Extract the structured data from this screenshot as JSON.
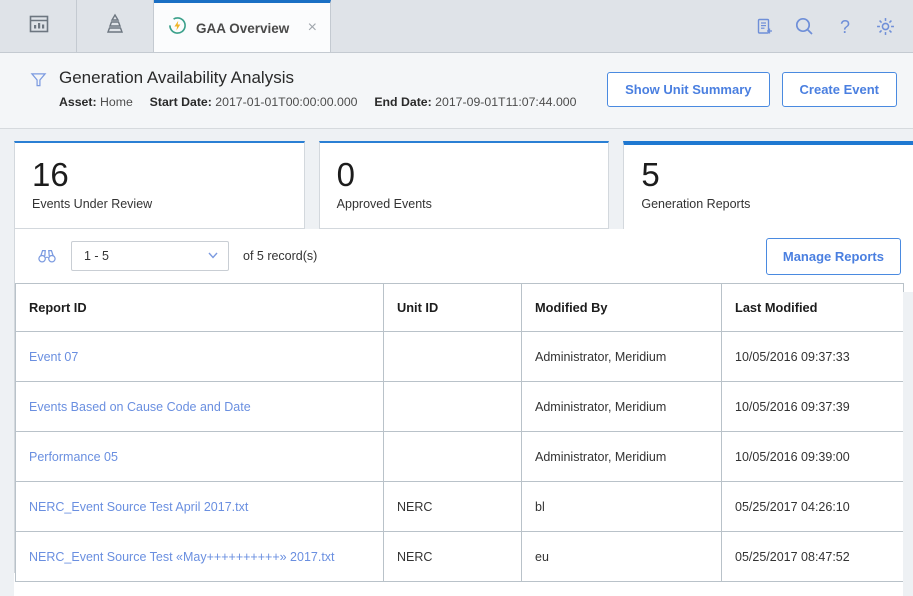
{
  "tabbar": {
    "tools": [
      {
        "name": "dashboard-icon",
        "label": "Dashboard"
      },
      {
        "name": "hierarchy-icon",
        "label": "Asset Hierarchy"
      }
    ],
    "document_tab": {
      "title": "GAA Overview",
      "icon": "gaa-bolt-icon",
      "close_label": "×"
    },
    "right_tools": [
      {
        "name": "new-document-icon",
        "label": "New"
      },
      {
        "name": "search-icon",
        "label": "Search"
      },
      {
        "name": "help-icon",
        "label": "Help"
      },
      {
        "name": "gear-icon",
        "label": "Settings"
      }
    ]
  },
  "header": {
    "filter_icon": "filter-funnel-icon",
    "title": "Generation Availability Analysis",
    "meta": {
      "asset_label": "Asset:",
      "asset_value": "Home",
      "start_label": "Start Date:",
      "start_value": "2017-01-01T00:00:00.000",
      "end_label": "End Date:",
      "end_value": "2017-09-01T11:07:44.000"
    },
    "buttons": {
      "show_unit_summary": "Show Unit Summary",
      "create_event": "Create Event"
    }
  },
  "cards": [
    {
      "value": "16",
      "label": "Events Under Review",
      "active": false
    },
    {
      "value": "0",
      "label": "Approved Events",
      "active": false
    },
    {
      "value": "5",
      "label": "Generation Reports",
      "active": true
    }
  ],
  "grid_toolbar": {
    "binoculars_icon": "binoculars-icon",
    "page_range": "1 - 5",
    "record_text": "of 5  record(s)",
    "manage_reports": "Manage Reports"
  },
  "table": {
    "columns": [
      "Report ID",
      "Unit ID",
      "Modified By",
      "Last Modified"
    ],
    "rows": [
      {
        "report_id": "Event 07",
        "unit_id": "",
        "modified_by": "Administrator, Meridium",
        "last_modified": "10/05/2016 09:37:33"
      },
      {
        "report_id": "Events Based on Cause Code and Date",
        "unit_id": "",
        "modified_by": "Administrator, Meridium",
        "last_modified": "10/05/2016 09:37:39"
      },
      {
        "report_id": "Performance 05",
        "unit_id": "",
        "modified_by": "Administrator, Meridium",
        "last_modified": "10/05/2016 09:39:00"
      },
      {
        "report_id": "NERC_Event Source Test April 2017.txt",
        "unit_id": "NERC",
        "modified_by": "bl",
        "last_modified": "05/25/2017 04:26:10"
      },
      {
        "report_id": "NERC_Event Source Test «May++++++++++» 2017.txt",
        "unit_id": "NERC",
        "modified_by": "eu",
        "last_modified": "05/25/2017 08:47:52"
      }
    ]
  },
  "colors": {
    "accent_blue": "#1f78d1",
    "link_blue": "#6a8fe0",
    "button_blue": "#4a7fe0",
    "tabbar_bg": "#dfe3e8",
    "panel_bg": "#eef1f4",
    "tab_icon_teal": "#3aa08a",
    "tab_icon_bolt": "#f0b429"
  }
}
